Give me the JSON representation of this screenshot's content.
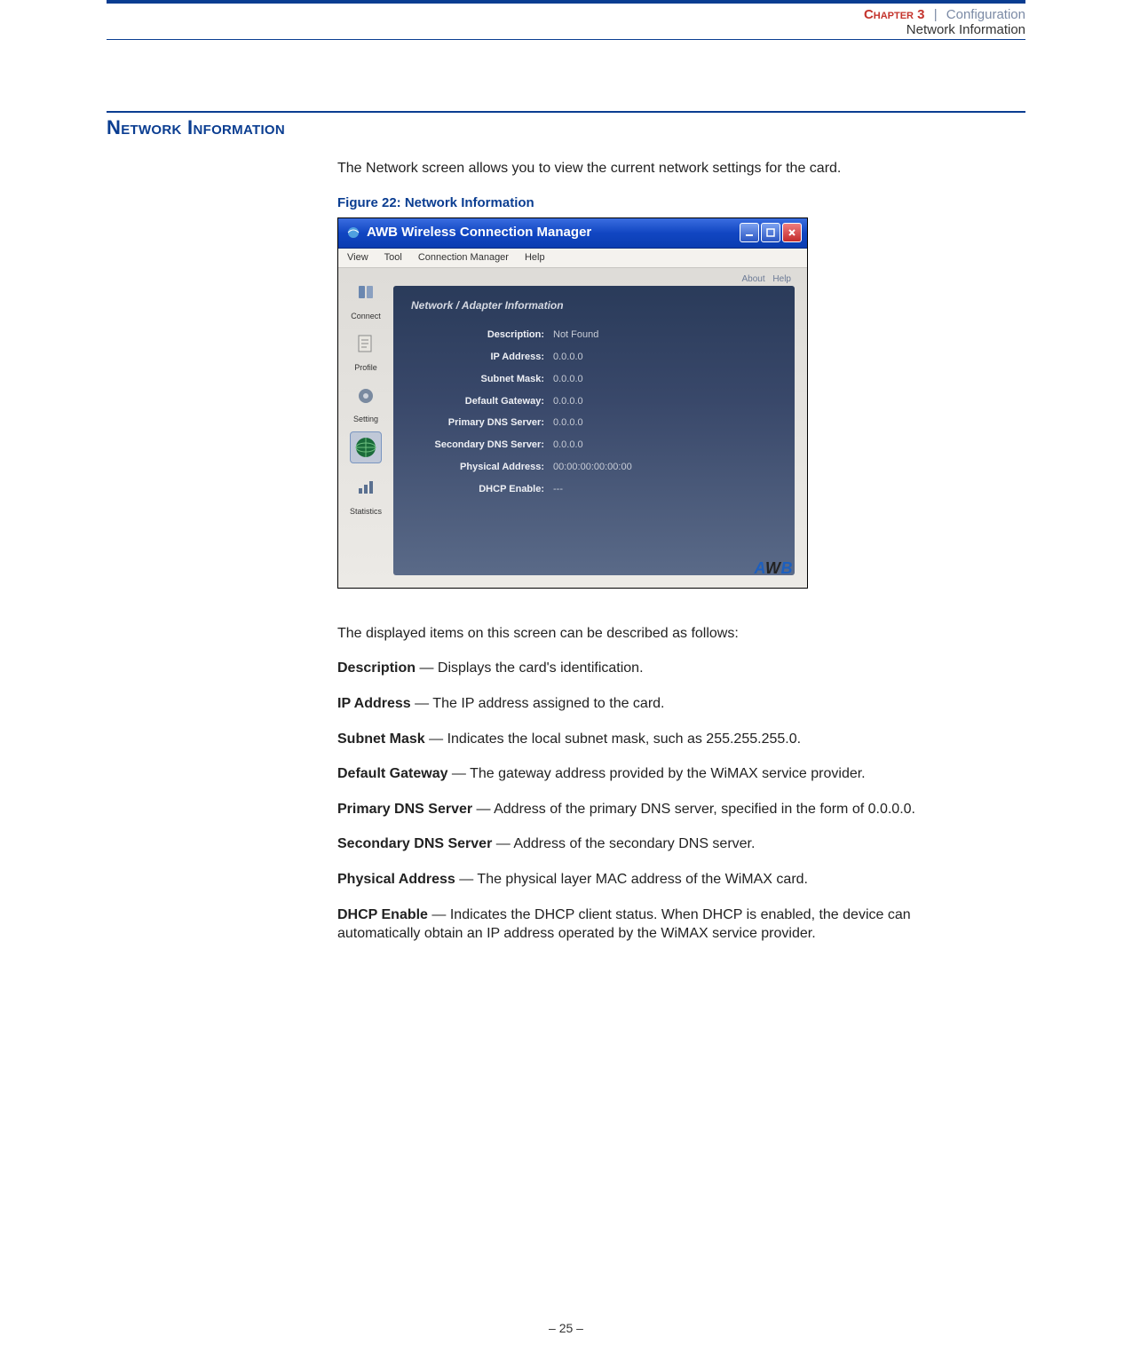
{
  "header": {
    "chapter_label": "Chapter 3",
    "separator": "|",
    "config_label": "Configuration",
    "sub_label": "Network Information"
  },
  "section_title": "Network Information",
  "intro_text": "The Network screen allows you to view the current network settings for the card.",
  "figure_caption": "Figure 22:  Network Information",
  "screenshot": {
    "title": "AWB Wireless Connection Manager",
    "menu": [
      "View",
      "Tool",
      "Connection Manager",
      "Help"
    ],
    "top_links": [
      "About",
      "Help"
    ],
    "sidebar": [
      {
        "label": "Connect",
        "icon": "connect"
      },
      {
        "label": "Profile",
        "icon": "profile"
      },
      {
        "label": "Setting",
        "icon": "setting"
      },
      {
        "label": "",
        "icon": "network",
        "active": true
      },
      {
        "label": "Statistics",
        "icon": "statistics"
      }
    ],
    "panel_title": "Network / Adapter Information",
    "fields": [
      {
        "label": "Description:",
        "value": "Not Found"
      },
      {
        "label": "IP Address:",
        "value": "0.0.0.0"
      },
      {
        "label": "Subnet Mask:",
        "value": "0.0.0.0"
      },
      {
        "label": "Default Gateway:",
        "value": "0.0.0.0"
      },
      {
        "label": "Primary DNS Server:",
        "value": "0.0.0.0"
      },
      {
        "label": "Secondary DNS Server:",
        "value": "0.0.0.0"
      },
      {
        "label": "Physical Address:",
        "value": "00:00:00:00:00:00"
      },
      {
        "label": "DHCP Enable:",
        "value": "---"
      }
    ],
    "logo_text_a": "A",
    "logo_text_w": "W",
    "logo_text_b": "B"
  },
  "post_figure_text": "The displayed items on this screen can be described as follows:",
  "definitions": [
    {
      "term": "Description",
      "text": " — Displays the card's identification."
    },
    {
      "term": "IP Address",
      "text": " — The IP address assigned to the card."
    },
    {
      "term": "Subnet Mask",
      "text": " — Indicates the local subnet mask, such as 255.255.255.0."
    },
    {
      "term": "Default Gateway",
      "text": " — The gateway address provided by the WiMAX service provider."
    },
    {
      "term": "Primary DNS Server",
      "text": " — Address of the primary DNS server, specified in the form of 0.0.0.0."
    },
    {
      "term": "Secondary DNS Server",
      "text": " — Address of the secondary DNS server."
    },
    {
      "term": "Physical Address",
      "text": " — The physical layer MAC address of the WiMAX card."
    },
    {
      "term": "DHCP Enable",
      "text": " — Indicates the DHCP client status. When DHCP is enabled, the device can automatically obtain an IP address operated by the WiMAX service provider."
    }
  ],
  "page_number": "–  25  –"
}
